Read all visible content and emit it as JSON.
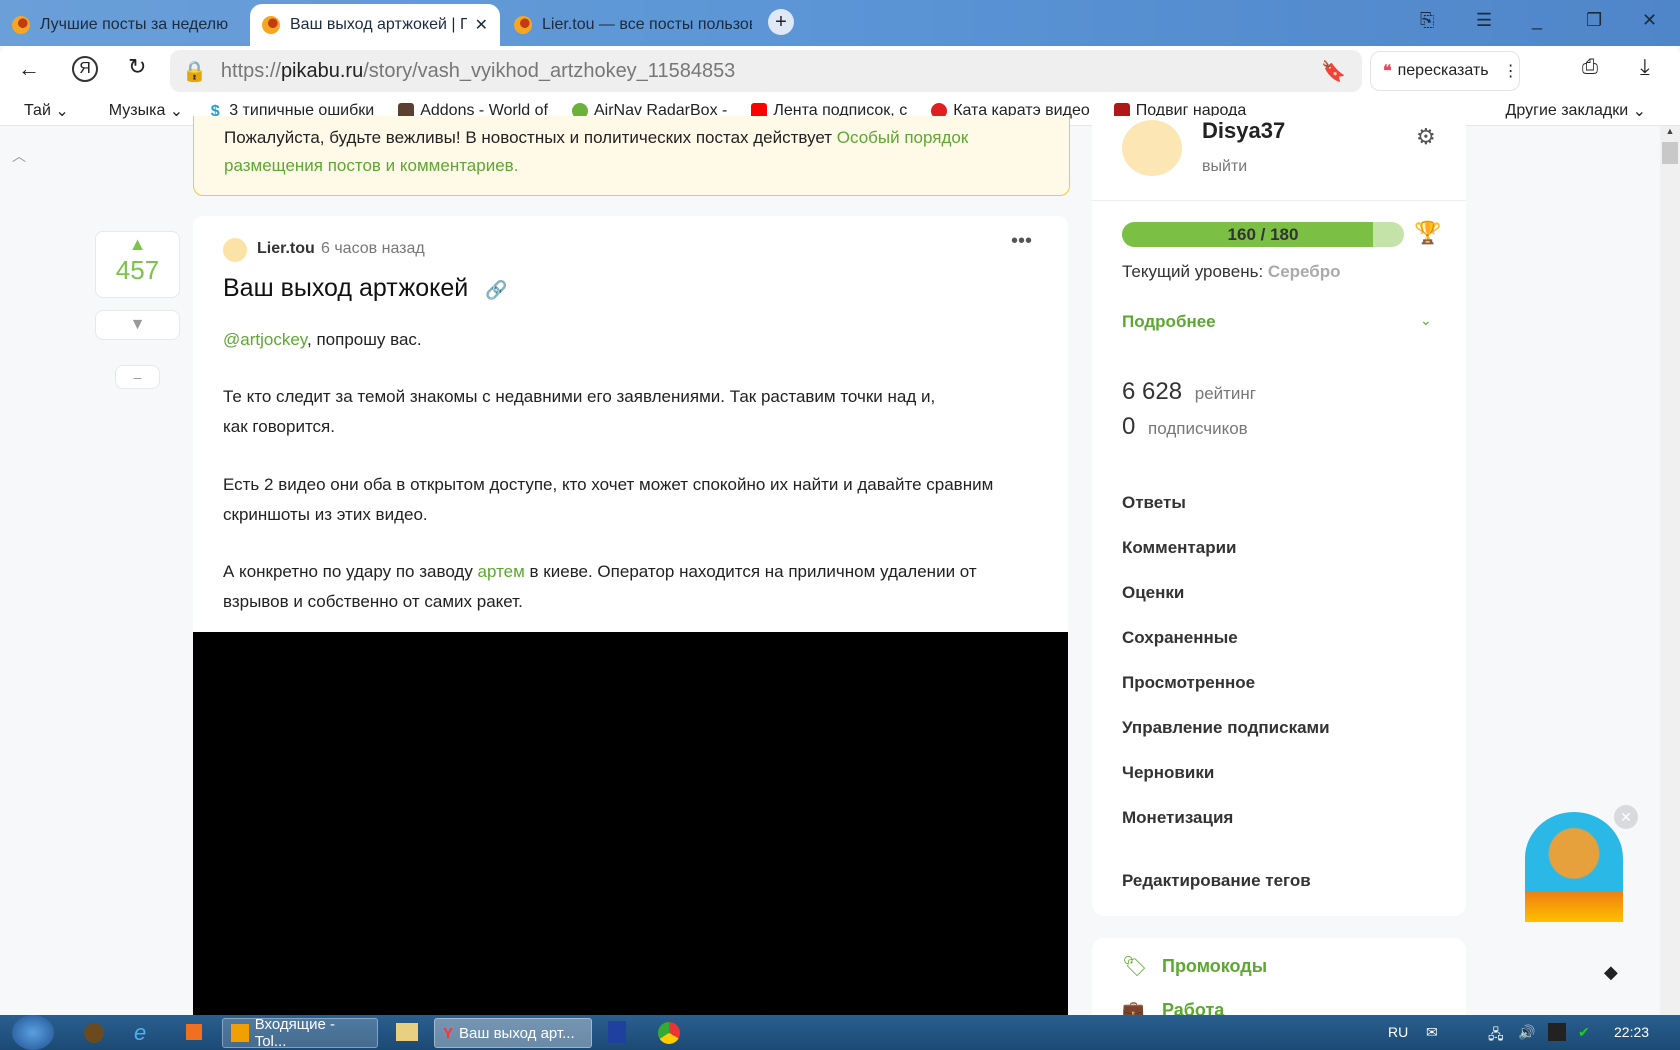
{
  "browser": {
    "tabs": [
      {
        "label": "Лучшие посты за неделю"
      },
      {
        "label": "Ваш выход артжокей | Пикабу"
      },
      {
        "label": "Lier.tou — все посты пользователя"
      }
    ],
    "url_prefix": "https://",
    "url_domain": "pikabu.ru",
    "url_path": "/story/vash_vyikhod_artzhokey_11584853",
    "retell_label": "пересказать",
    "bookmarks": [
      "Тай",
      "Музыка",
      "3 типичные ошибки",
      "Addons - World of",
      "AirNav RadarBox -",
      "Лента подписок, с",
      "Ката каратэ видео",
      "Подвиг народа"
    ],
    "other_bookmarks": "Другие закладки"
  },
  "notice": {
    "text": "Пожалуйста, будьте вежливы! В новостных и политических постах действует ",
    "link": "Особый порядок размещения постов и комментариев."
  },
  "post": {
    "rating": "457",
    "minus": "–",
    "author": "Lier.tou",
    "time": "6 часов назад",
    "title": "Ваш выход артжокей",
    "mention": "@artjockey",
    "p1_rest": ", попрошу вас.",
    "p2": "Те кто следит за темой знакомы с недавними его заявлениями. Так раставим точки над и,",
    "p2b": "как говорится.",
    "p3": "Есть 2 видео они оба в открытом доступе, кто хочет может спокойно их найти и давайте сравним",
    "p3b": "скриншоты из этих видео.",
    "p4a": "А конкретно по удару по заводу ",
    "p4link": "артем",
    "p4b": " в киеве. Оператор находится на приличном удалении от",
    "p4c": "взрывов и собственно от самих ракет."
  },
  "sidebar": {
    "username": "Disya37",
    "logout": "выйти",
    "progress_text": "160 / 180",
    "progress_value": 160,
    "progress_max": 180,
    "level_label": "Текущий уровень: ",
    "level": "Серебро",
    "more": "Подробнее",
    "rating_value": "6 628",
    "rating_label": "рейтинг",
    "subs_value": "0",
    "subs_label": "подписчиков",
    "menu": [
      "Ответы",
      "Комментарии",
      "Оценки",
      "Сохраненные",
      "Просмотренное",
      "Управление подписками",
      "Черновики",
      "Монетизация"
    ],
    "edit_tags": "Редактирование тегов",
    "promo": "Промокоды",
    "work": "Работа"
  },
  "taskbar": {
    "items": [
      "Входящие - Tol...",
      "Ваш выход арт..."
    ],
    "lang": "RU",
    "clock": "22:23"
  }
}
